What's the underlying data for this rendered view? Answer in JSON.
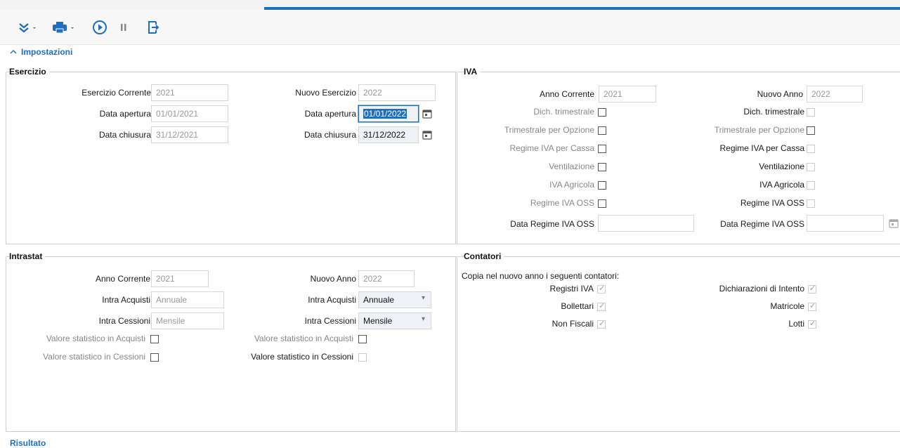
{
  "toolbar": {
    "icons": [
      "expand-all-icon",
      "print-icon",
      "play-icon",
      "pause-icon",
      "exit-icon"
    ],
    "accent": "#1f6fc1"
  },
  "section": {
    "title": "Impostazioni"
  },
  "esercizio": {
    "legend": "Esercizio",
    "corrente_label": "Esercizio Corrente",
    "corrente_value": "2021",
    "apertura_label": "Data apertura",
    "apertura_value": "01/01/2021",
    "chiusura_label": "Data chiusura",
    "chiusura_value": "31/12/2021",
    "nuovo_label": "Nuovo Esercizio",
    "nuovo_value": "2022",
    "nuovo_apertura_label": "Data apertura",
    "nuovo_apertura_value": "01/01/2022",
    "nuovo_chiusura_label": "Data chiusura",
    "nuovo_chiusura_value": "31/12/2022"
  },
  "iva": {
    "legend": "IVA",
    "anno_corrente_label": "Anno Corrente",
    "anno_corrente_value": "2021",
    "nuovo_anno_label": "Nuovo Anno",
    "nuovo_anno_value": "2022",
    "dich_trimestrale": "Dich. trimestrale",
    "trimestrale_opzione": "Trimestrale per Opzione",
    "regime_cassa": "Regime IVA per Cassa",
    "ventilazione": "Ventilazione",
    "agricola": "IVA Agricola",
    "oss": "Regime IVA OSS",
    "data_oss": "Data Regime IVA OSS",
    "data_oss_value": "",
    "nuovo_data_oss_value": ""
  },
  "intrastat": {
    "legend": "Intrastat",
    "anno_corrente_label": "Anno Corrente",
    "anno_corrente_value": "2021",
    "nuovo_anno_label": "Nuovo Anno",
    "nuovo_anno_value": "2022",
    "acquisti_label": "Intra Acquisti",
    "acquisti_value": "Annuale",
    "cessioni_label": "Intra Cessioni",
    "cessioni_value": "Mensile",
    "new_acquisti_value": "Annuale",
    "new_cessioni_value": "Mensile",
    "valore_acquisti": "Valore statistico in Acquisti",
    "valore_cessioni": "Valore statistico in Cessioni"
  },
  "contatori": {
    "legend": "Contatori",
    "intro": "Copia nel nuovo anno i seguenti contatori:",
    "registri_iva": "Registri IVA",
    "bollettari": "Bollettari",
    "non_fiscali": "Non Fiscali",
    "dichiarazioni_intento": "Dichiarazioni di Intento",
    "matricole": "Matricole",
    "lotti": "Lotti"
  },
  "result": {
    "title": "Risultato"
  }
}
